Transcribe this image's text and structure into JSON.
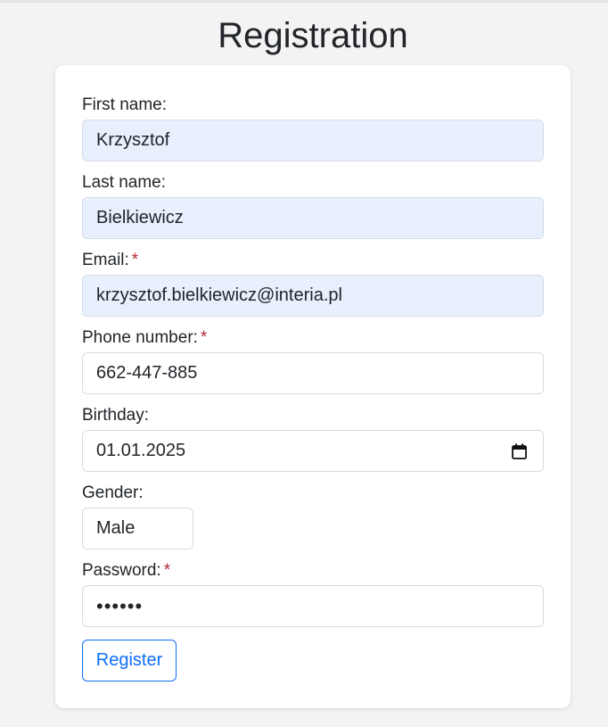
{
  "page": {
    "title": "Registration"
  },
  "form": {
    "first_name": {
      "label": "First name:",
      "value": "Krzysztof"
    },
    "last_name": {
      "label": "Last name:",
      "value": "Bielkiewicz"
    },
    "email": {
      "label": "Email:",
      "required_mark": "*",
      "value": "krzysztof.bielkiewicz@interia.pl"
    },
    "phone": {
      "label": "Phone number:",
      "required_mark": "*",
      "value": "662-447-885"
    },
    "birthday": {
      "label": "Birthday:",
      "value": "01.01.2025",
      "icon": "calendar-icon"
    },
    "gender": {
      "label": "Gender:",
      "value": "Male"
    },
    "password": {
      "label": "Password:",
      "required_mark": "*",
      "masked_value": "••••••"
    },
    "submit_label": "Register"
  },
  "colors": {
    "background": "#f3f3f3",
    "card": "#ffffff",
    "autofill": "#e8f0fe",
    "primary": "#0d6efd",
    "required": "#b02a37"
  }
}
